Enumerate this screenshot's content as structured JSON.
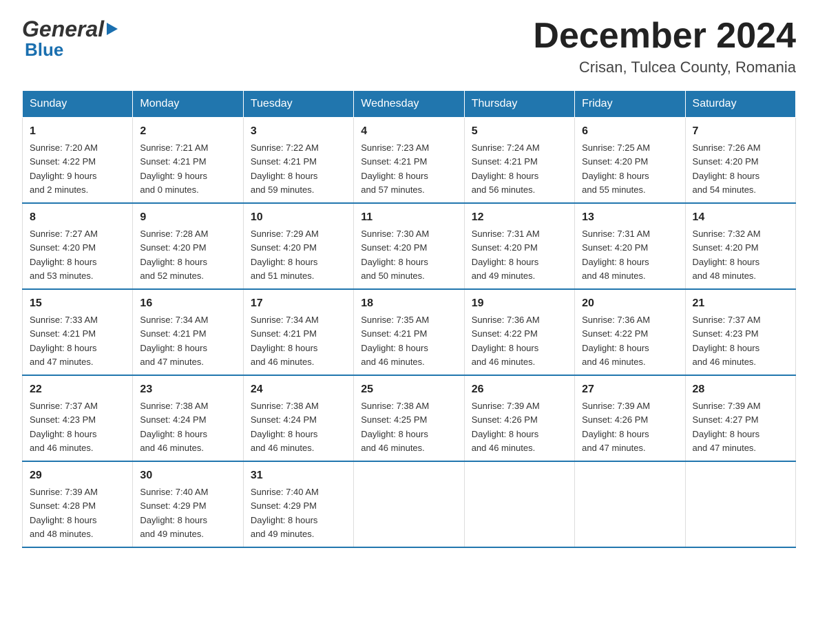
{
  "header": {
    "logo_top": "General",
    "logo_arrow": "▶",
    "logo_bottom": "Blue",
    "month_title": "December 2024",
    "location": "Crisan, Tulcea County, Romania"
  },
  "days_of_week": [
    "Sunday",
    "Monday",
    "Tuesday",
    "Wednesday",
    "Thursday",
    "Friday",
    "Saturday"
  ],
  "weeks": [
    [
      {
        "day": "1",
        "sunrise": "Sunrise: 7:20 AM",
        "sunset": "Sunset: 4:22 PM",
        "daylight": "Daylight: 9 hours",
        "daylight2": "and 2 minutes."
      },
      {
        "day": "2",
        "sunrise": "Sunrise: 7:21 AM",
        "sunset": "Sunset: 4:21 PM",
        "daylight": "Daylight: 9 hours",
        "daylight2": "and 0 minutes."
      },
      {
        "day": "3",
        "sunrise": "Sunrise: 7:22 AM",
        "sunset": "Sunset: 4:21 PM",
        "daylight": "Daylight: 8 hours",
        "daylight2": "and 59 minutes."
      },
      {
        "day": "4",
        "sunrise": "Sunrise: 7:23 AM",
        "sunset": "Sunset: 4:21 PM",
        "daylight": "Daylight: 8 hours",
        "daylight2": "and 57 minutes."
      },
      {
        "day": "5",
        "sunrise": "Sunrise: 7:24 AM",
        "sunset": "Sunset: 4:21 PM",
        "daylight": "Daylight: 8 hours",
        "daylight2": "and 56 minutes."
      },
      {
        "day": "6",
        "sunrise": "Sunrise: 7:25 AM",
        "sunset": "Sunset: 4:20 PM",
        "daylight": "Daylight: 8 hours",
        "daylight2": "and 55 minutes."
      },
      {
        "day": "7",
        "sunrise": "Sunrise: 7:26 AM",
        "sunset": "Sunset: 4:20 PM",
        "daylight": "Daylight: 8 hours",
        "daylight2": "and 54 minutes."
      }
    ],
    [
      {
        "day": "8",
        "sunrise": "Sunrise: 7:27 AM",
        "sunset": "Sunset: 4:20 PM",
        "daylight": "Daylight: 8 hours",
        "daylight2": "and 53 minutes."
      },
      {
        "day": "9",
        "sunrise": "Sunrise: 7:28 AM",
        "sunset": "Sunset: 4:20 PM",
        "daylight": "Daylight: 8 hours",
        "daylight2": "and 52 minutes."
      },
      {
        "day": "10",
        "sunrise": "Sunrise: 7:29 AM",
        "sunset": "Sunset: 4:20 PM",
        "daylight": "Daylight: 8 hours",
        "daylight2": "and 51 minutes."
      },
      {
        "day": "11",
        "sunrise": "Sunrise: 7:30 AM",
        "sunset": "Sunset: 4:20 PM",
        "daylight": "Daylight: 8 hours",
        "daylight2": "and 50 minutes."
      },
      {
        "day": "12",
        "sunrise": "Sunrise: 7:31 AM",
        "sunset": "Sunset: 4:20 PM",
        "daylight": "Daylight: 8 hours",
        "daylight2": "and 49 minutes."
      },
      {
        "day": "13",
        "sunrise": "Sunrise: 7:31 AM",
        "sunset": "Sunset: 4:20 PM",
        "daylight": "Daylight: 8 hours",
        "daylight2": "and 48 minutes."
      },
      {
        "day": "14",
        "sunrise": "Sunrise: 7:32 AM",
        "sunset": "Sunset: 4:20 PM",
        "daylight": "Daylight: 8 hours",
        "daylight2": "and 48 minutes."
      }
    ],
    [
      {
        "day": "15",
        "sunrise": "Sunrise: 7:33 AM",
        "sunset": "Sunset: 4:21 PM",
        "daylight": "Daylight: 8 hours",
        "daylight2": "and 47 minutes."
      },
      {
        "day": "16",
        "sunrise": "Sunrise: 7:34 AM",
        "sunset": "Sunset: 4:21 PM",
        "daylight": "Daylight: 8 hours",
        "daylight2": "and 47 minutes."
      },
      {
        "day": "17",
        "sunrise": "Sunrise: 7:34 AM",
        "sunset": "Sunset: 4:21 PM",
        "daylight": "Daylight: 8 hours",
        "daylight2": "and 46 minutes."
      },
      {
        "day": "18",
        "sunrise": "Sunrise: 7:35 AM",
        "sunset": "Sunset: 4:21 PM",
        "daylight": "Daylight: 8 hours",
        "daylight2": "and 46 minutes."
      },
      {
        "day": "19",
        "sunrise": "Sunrise: 7:36 AM",
        "sunset": "Sunset: 4:22 PM",
        "daylight": "Daylight: 8 hours",
        "daylight2": "and 46 minutes."
      },
      {
        "day": "20",
        "sunrise": "Sunrise: 7:36 AM",
        "sunset": "Sunset: 4:22 PM",
        "daylight": "Daylight: 8 hours",
        "daylight2": "and 46 minutes."
      },
      {
        "day": "21",
        "sunrise": "Sunrise: 7:37 AM",
        "sunset": "Sunset: 4:23 PM",
        "daylight": "Daylight: 8 hours",
        "daylight2": "and 46 minutes."
      }
    ],
    [
      {
        "day": "22",
        "sunrise": "Sunrise: 7:37 AM",
        "sunset": "Sunset: 4:23 PM",
        "daylight": "Daylight: 8 hours",
        "daylight2": "and 46 minutes."
      },
      {
        "day": "23",
        "sunrise": "Sunrise: 7:38 AM",
        "sunset": "Sunset: 4:24 PM",
        "daylight": "Daylight: 8 hours",
        "daylight2": "and 46 minutes."
      },
      {
        "day": "24",
        "sunrise": "Sunrise: 7:38 AM",
        "sunset": "Sunset: 4:24 PM",
        "daylight": "Daylight: 8 hours",
        "daylight2": "and 46 minutes."
      },
      {
        "day": "25",
        "sunrise": "Sunrise: 7:38 AM",
        "sunset": "Sunset: 4:25 PM",
        "daylight": "Daylight: 8 hours",
        "daylight2": "and 46 minutes."
      },
      {
        "day": "26",
        "sunrise": "Sunrise: 7:39 AM",
        "sunset": "Sunset: 4:26 PM",
        "daylight": "Daylight: 8 hours",
        "daylight2": "and 46 minutes."
      },
      {
        "day": "27",
        "sunrise": "Sunrise: 7:39 AM",
        "sunset": "Sunset: 4:26 PM",
        "daylight": "Daylight: 8 hours",
        "daylight2": "and 47 minutes."
      },
      {
        "day": "28",
        "sunrise": "Sunrise: 7:39 AM",
        "sunset": "Sunset: 4:27 PM",
        "daylight": "Daylight: 8 hours",
        "daylight2": "and 47 minutes."
      }
    ],
    [
      {
        "day": "29",
        "sunrise": "Sunrise: 7:39 AM",
        "sunset": "Sunset: 4:28 PM",
        "daylight": "Daylight: 8 hours",
        "daylight2": "and 48 minutes."
      },
      {
        "day": "30",
        "sunrise": "Sunrise: 7:40 AM",
        "sunset": "Sunset: 4:29 PM",
        "daylight": "Daylight: 8 hours",
        "daylight2": "and 49 minutes."
      },
      {
        "day": "31",
        "sunrise": "Sunrise: 7:40 AM",
        "sunset": "Sunset: 4:29 PM",
        "daylight": "Daylight: 8 hours",
        "daylight2": "and 49 minutes."
      },
      null,
      null,
      null,
      null
    ]
  ]
}
